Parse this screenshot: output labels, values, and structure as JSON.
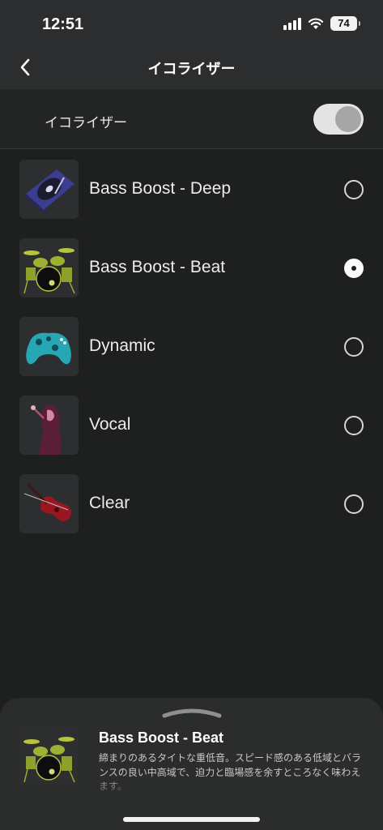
{
  "status": {
    "time": "12:51",
    "battery": "74"
  },
  "nav": {
    "title": "イコライザー",
    "back_icon": "chevron-left-icon"
  },
  "toggle": {
    "label": "イコライザー",
    "on": true
  },
  "presets": [
    {
      "label": "Bass Boost - Deep",
      "icon": "turntable-icon",
      "selected": false
    },
    {
      "label": "Bass Boost - Beat",
      "icon": "drum-kit-icon",
      "selected": true
    },
    {
      "label": "Dynamic",
      "icon": "game-controller-icon",
      "selected": false
    },
    {
      "label": "Vocal",
      "icon": "singer-icon",
      "selected": false
    },
    {
      "label": "Clear",
      "icon": "violin-icon",
      "selected": false
    }
  ],
  "detail": {
    "title": "Bass Boost - Beat",
    "description": "締まりのあるタイトな重低音。スピード感のある低域とバランスの良い中高域で、迫力と臨場感を余すところなく味わえます。",
    "icon": "drum-kit-icon"
  },
  "colors": {
    "background": "#1e1f1f",
    "header": "#2c2d2e",
    "sheet": "#2b2c2c",
    "toggle_track": "#e4e4e4",
    "toggle_knob": "#a6a6a6"
  }
}
